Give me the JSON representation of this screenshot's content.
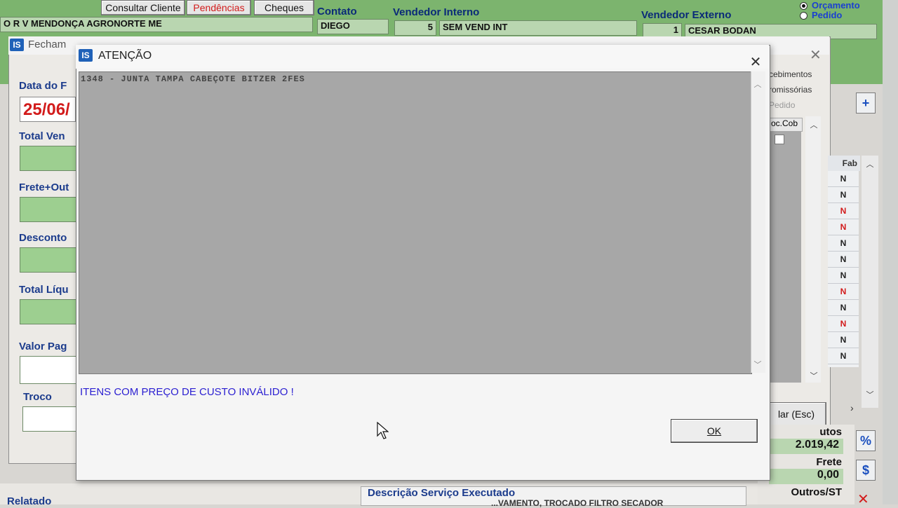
{
  "header": {
    "buttons": {
      "consultar_cliente": "Consultar Cliente",
      "pendencias": "Pendências",
      "cheques": "Cheques"
    },
    "contato_label": "Contato",
    "vendedor_interno_label": "Vendedor Interno",
    "vendedor_externo_label": "Vendedor Externo",
    "cliente_nome": "O R V MENDONÇA AGRONORTE ME",
    "contato_value": "DIEGO",
    "vend_int_code": "5",
    "vend_int_name": "SEM VEND INT",
    "vend_ext_code": "1",
    "vend_ext_name": "CESAR BODAN",
    "radio_orcamento": "Orçamento",
    "radio_pedido": "Pedido"
  },
  "fechamento": {
    "title": "Fecham",
    "labels": {
      "data": "Data do F",
      "total_venda": "Total Ven",
      "frete": "Frete+Out",
      "desconto": "Desconto",
      "total_liquido": "Total Líqu",
      "valor_pago": "Valor Pag",
      "troco": "Troco"
    },
    "date_value": "25/06/",
    "right_list": [
      "cebimentos",
      "romissórias",
      "Pedido"
    ],
    "doc_cob_header": "oc.Cob",
    "grid_header": {
      "fab": "Fab"
    },
    "grid_values": [
      "N",
      "N",
      "N",
      "N",
      "N",
      "N",
      "N",
      "N",
      "N",
      "N",
      "N",
      "N"
    ],
    "grid_red_rows": [
      2,
      3,
      7,
      9
    ],
    "cancel_text": "lar (Esc)"
  },
  "summary": {
    "produtos_label": "utos",
    "produtos_value": "2.019,42",
    "frete_label": "Frete",
    "frete_value": "0,00",
    "outros_label": "Outros/ST",
    "buttons": {
      "percent": "%",
      "dollar": "$",
      "plus": "+"
    }
  },
  "dialog": {
    "title": "ATENÇÃO",
    "memo_line": "1348 - JUNTA TAMPA CABEÇOTE BITZER 2FES",
    "message": "ITENS COM PREÇO DE CUSTO INVÁLIDO !",
    "ok_label": "OK"
  },
  "bottom": {
    "relatado": "Relatado",
    "descricao": "Descrição Serviço Executado",
    "descricao_text": "...VAMENTO, TROCADO FILTRO SECADOR"
  }
}
